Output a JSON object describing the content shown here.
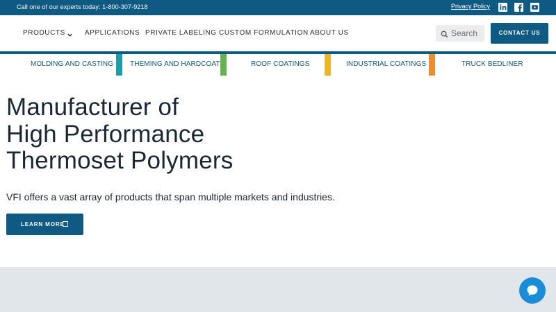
{
  "topbar": {
    "call_text": "Call one of our experts today: 1-800-307-9218",
    "privacy_label": "Privacy Policy",
    "social": [
      "linkedin-icon",
      "facebook-icon",
      "youtube-icon"
    ]
  },
  "nav": {
    "items": [
      {
        "label": "PRODUCTS",
        "has_dropdown": true
      },
      {
        "label": "APPLICATIONS"
      },
      {
        "label": "PRIVATE LABELING"
      },
      {
        "label": "CUSTOM FORMULATION"
      },
      {
        "label": "ABOUT US"
      }
    ],
    "search_placeholder": "Search",
    "contact_label": "CONTACT US"
  },
  "categories": [
    {
      "label": "MOLDING AND CASTING"
    },
    {
      "label": "THEMING AND HARDCOATS"
    },
    {
      "label": "ROOF COATINGS"
    },
    {
      "label": "INDUSTRIAL COATINGS"
    },
    {
      "label": "TRUCK BEDLINER"
    }
  ],
  "category_colors": [
    "#11a2ad",
    "#62b54a",
    "#f3b51c",
    "#f38c26"
  ],
  "hero": {
    "title_lines": [
      "Manufacturer of",
      "High Performance",
      "Thermoset Polymers"
    ],
    "subtitle": "VFI offers a vast array of products that span multiple markets and industries.",
    "cta_label": "LEARN MORE"
  },
  "colors": {
    "brand": "#0f5a82",
    "lower_band": "#e1e6ea",
    "chat": "#1a8dd8"
  }
}
